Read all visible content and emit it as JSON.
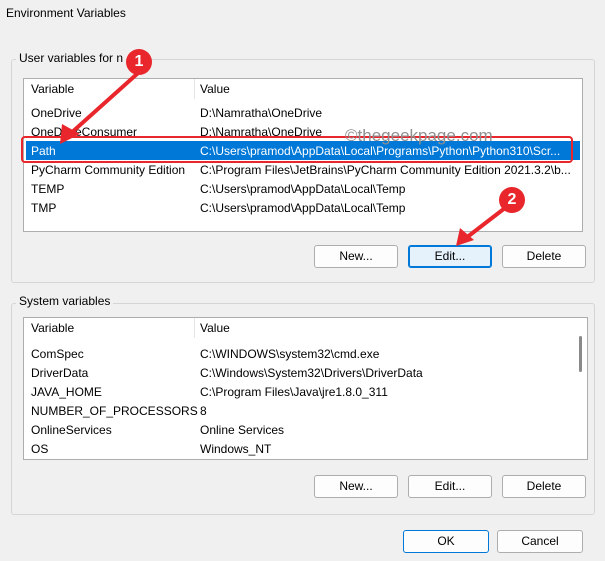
{
  "window": {
    "title": "Environment Variables"
  },
  "user_section": {
    "label": "User variables for n",
    "columns": [
      "Variable",
      "Value"
    ],
    "rows": [
      {
        "variable": "OneDrive",
        "value": "D:\\Namratha\\OneDrive"
      },
      {
        "variable": "OneDriveConsumer",
        "value": "D:\\Namratha\\OneDrive"
      },
      {
        "variable": "Path",
        "value": "C:\\Users\\pramod\\AppData\\Local\\Programs\\Python\\Python310\\Scr..."
      },
      {
        "variable": "PyCharm Community Edition",
        "value": "C:\\Program Files\\JetBrains\\PyCharm Community Edition 2021.3.2\\b..."
      },
      {
        "variable": "TEMP",
        "value": "C:\\Users\\pramod\\AppData\\Local\\Temp"
      },
      {
        "variable": "TMP",
        "value": "C:\\Users\\pramod\\AppData\\Local\\Temp"
      }
    ],
    "buttons": {
      "new": "New...",
      "edit": "Edit...",
      "delete": "Delete"
    }
  },
  "system_section": {
    "label": "System variables",
    "columns": [
      "Variable",
      "Value"
    ],
    "rows": [
      {
        "variable": "ComSpec",
        "value": "C:\\WINDOWS\\system32\\cmd.exe"
      },
      {
        "variable": "DriverData",
        "value": "C:\\Windows\\System32\\Drivers\\DriverData"
      },
      {
        "variable": "JAVA_HOME",
        "value": "C:\\Program Files\\Java\\jre1.8.0_311"
      },
      {
        "variable": "NUMBER_OF_PROCESSORS",
        "value": "8"
      },
      {
        "variable": "OnlineServices",
        "value": "Online Services"
      },
      {
        "variable": "OS",
        "value": "Windows_NT"
      }
    ],
    "buttons": {
      "new": "New...",
      "edit": "Edit...",
      "delete": "Delete"
    }
  },
  "footer": {
    "ok": "OK",
    "cancel": "Cancel"
  },
  "annotations": {
    "badge1": "1",
    "badge2": "2",
    "watermark": "©thegeekpage.com"
  },
  "colors": {
    "selection": "#0078d7",
    "annotation_red": "#e8262b"
  }
}
